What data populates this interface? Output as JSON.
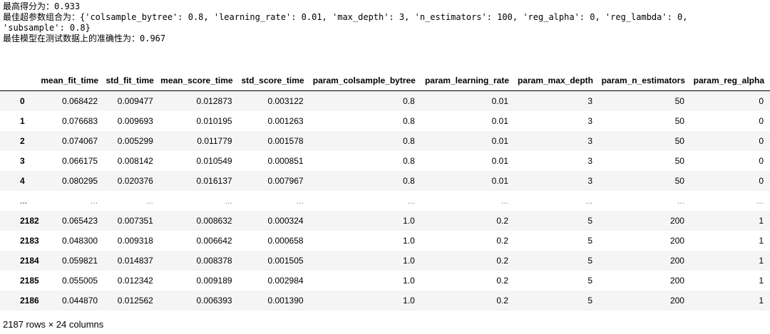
{
  "stdout": {
    "line1": "最高得分为：0.933",
    "line2": "最佳超参数组合为：{'colsample_bytree': 0.8, 'learning_rate': 0.01, 'max_depth': 3, 'n_estimators': 100, 'reg_alpha': 0, 'reg_lambda': 0,",
    "line3": "'subsample': 0.8}",
    "line4": "最佳模型在测试数据上的准确性为：0.967"
  },
  "table": {
    "columns": [
      "",
      "mean_fit_time",
      "std_fit_time",
      "mean_score_time",
      "std_score_time",
      "param_colsample_bytree",
      "param_learning_rate",
      "param_max_depth",
      "param_n_estimators",
      "param_reg_alpha"
    ],
    "rows": [
      {
        "index": "0",
        "cells": [
          "0.068422",
          "0.009477",
          "0.012873",
          "0.003122",
          "0.8",
          "0.01",
          "3",
          "50",
          "0"
        ]
      },
      {
        "index": "1",
        "cells": [
          "0.076683",
          "0.009693",
          "0.010195",
          "0.001263",
          "0.8",
          "0.01",
          "3",
          "50",
          "0"
        ]
      },
      {
        "index": "2",
        "cells": [
          "0.074067",
          "0.005299",
          "0.011779",
          "0.001578",
          "0.8",
          "0.01",
          "3",
          "50",
          "0"
        ]
      },
      {
        "index": "3",
        "cells": [
          "0.066175",
          "0.008142",
          "0.010549",
          "0.000851",
          "0.8",
          "0.01",
          "3",
          "50",
          "0"
        ]
      },
      {
        "index": "4",
        "cells": [
          "0.080295",
          "0.020376",
          "0.016137",
          "0.007967",
          "0.8",
          "0.01",
          "3",
          "50",
          "0"
        ]
      },
      {
        "index": "...",
        "cells": [
          "...",
          "...",
          "...",
          "...",
          "...",
          "...",
          "...",
          "...",
          "..."
        ],
        "ellipsis": true
      },
      {
        "index": "2182",
        "cells": [
          "0.065423",
          "0.007351",
          "0.008632",
          "0.000324",
          "1.0",
          "0.2",
          "5",
          "200",
          "1"
        ]
      },
      {
        "index": "2183",
        "cells": [
          "0.048300",
          "0.009318",
          "0.006642",
          "0.000658",
          "1.0",
          "0.2",
          "5",
          "200",
          "1"
        ]
      },
      {
        "index": "2184",
        "cells": [
          "0.059821",
          "0.014837",
          "0.008378",
          "0.001505",
          "1.0",
          "0.2",
          "5",
          "200",
          "1"
        ]
      },
      {
        "index": "2185",
        "cells": [
          "0.055005",
          "0.012342",
          "0.009189",
          "0.002984",
          "1.0",
          "0.2",
          "5",
          "200",
          "1"
        ]
      },
      {
        "index": "2186",
        "cells": [
          "0.044870",
          "0.012562",
          "0.006393",
          "0.001390",
          "1.0",
          "0.2",
          "5",
          "200",
          "1"
        ]
      }
    ]
  },
  "shape_text": "2187 rows × 24 columns"
}
